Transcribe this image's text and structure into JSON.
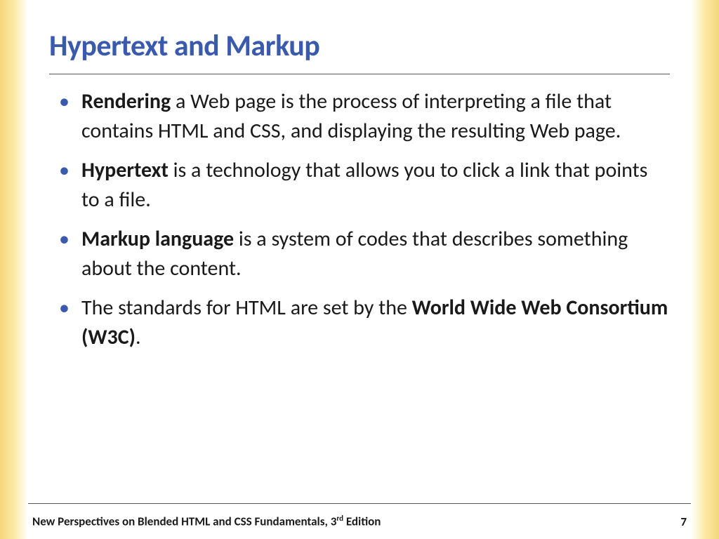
{
  "slide": {
    "title": "Hypertext and Markup",
    "bullets": [
      {
        "bold": "Rendering",
        "rest": " a Web page is the process of interpreting a file that contains HTML and CSS, and displaying the resulting Web page."
      },
      {
        "bold": "Hypertext",
        "rest": " is a technology that allows you to click a link that points to a file."
      },
      {
        "bold": "Markup language",
        "rest": " is a system of codes that describes something about the content."
      },
      {
        "prefix": "The standards for HTML are set by the ",
        "bold": "World Wide Web Consortium (W3C)",
        "suffix": "."
      }
    ]
  },
  "footer": {
    "book_title_prefix": "New Perspectives on Blended HTML and CSS Fundamentals, 3",
    "book_title_sup": "rd",
    "book_title_suffix": " Edition",
    "page_number": "7"
  }
}
